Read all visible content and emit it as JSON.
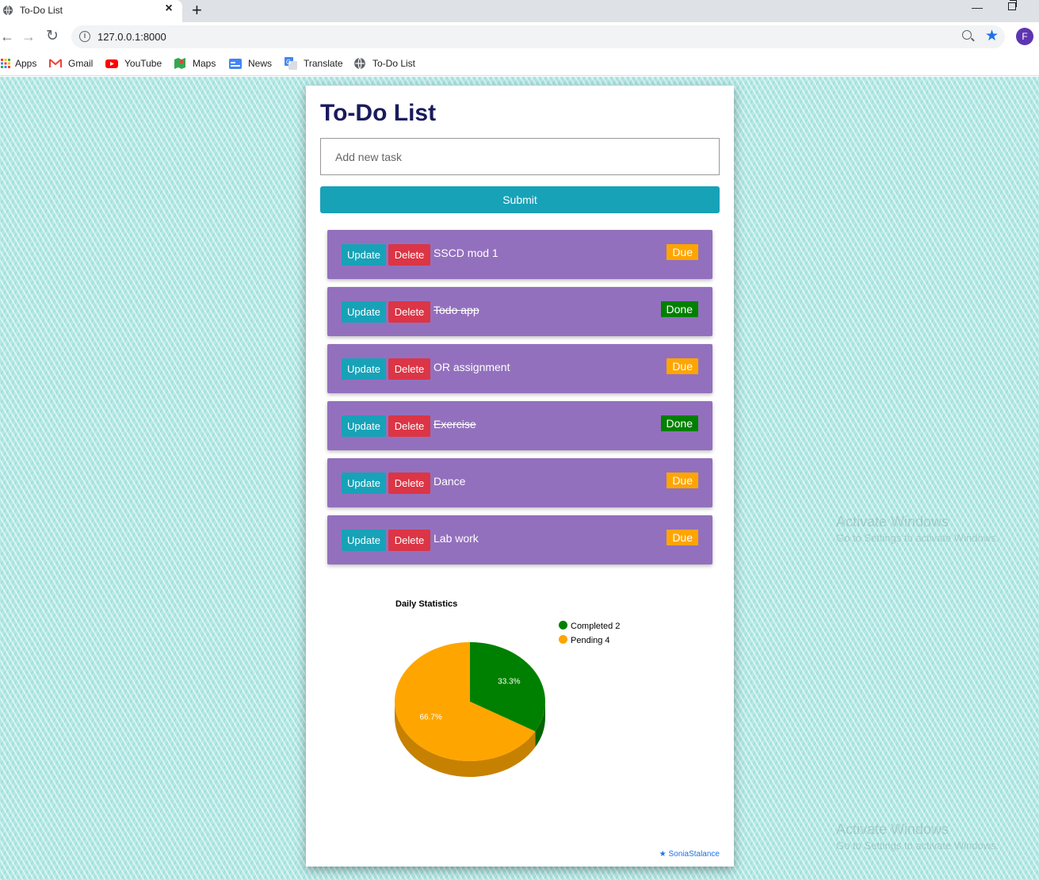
{
  "browser": {
    "tab_title": "To-Do List",
    "tab_close": "×",
    "new_tab": "+",
    "url": "127.0.0.1:8000",
    "profile_initial": "F",
    "bookmarks": [
      "Apps",
      "Gmail",
      "YouTube",
      "Maps",
      "News",
      "Translate",
      "To-Do List"
    ]
  },
  "app": {
    "title": "To-Do List",
    "input_placeholder": "Add new task",
    "submit_label": "Submit",
    "update_label": "Update",
    "delete_label": "Delete",
    "tasks": [
      {
        "name": "SSCD mod 1",
        "status": "Due",
        "done": false
      },
      {
        "name": "Todo app",
        "status": "Done",
        "done": true
      },
      {
        "name": "OR assignment",
        "status": "Due",
        "done": false
      },
      {
        "name": "Exercise",
        "status": "Done",
        "done": true
      },
      {
        "name": "Dance",
        "status": "Due",
        "done": false
      },
      {
        "name": "Lab work",
        "status": "Due",
        "done": false
      }
    ],
    "colors": {
      "due": "#ffa500",
      "done": "#008000",
      "task_bg": "#9370bd",
      "update": "#17a2b8",
      "delete": "#dc3545"
    },
    "credit": "★ SoniaStalance"
  },
  "chart_data": {
    "type": "pie",
    "title": "Daily Statistics",
    "categories": [
      "Completed 2",
      "Pending 4"
    ],
    "values": [
      2,
      4
    ],
    "slice_labels": [
      "33.3%",
      "66.7%"
    ],
    "colors": [
      "#008000",
      "#ffa500"
    ],
    "legend": "top-right",
    "style": "3d"
  },
  "watermarks": [
    {
      "title": "Activate Windows",
      "sub": "Go to Settings to activate Windows."
    },
    {
      "title": "Activate Windows",
      "sub": "Go to Settings to activate Windows."
    }
  ]
}
